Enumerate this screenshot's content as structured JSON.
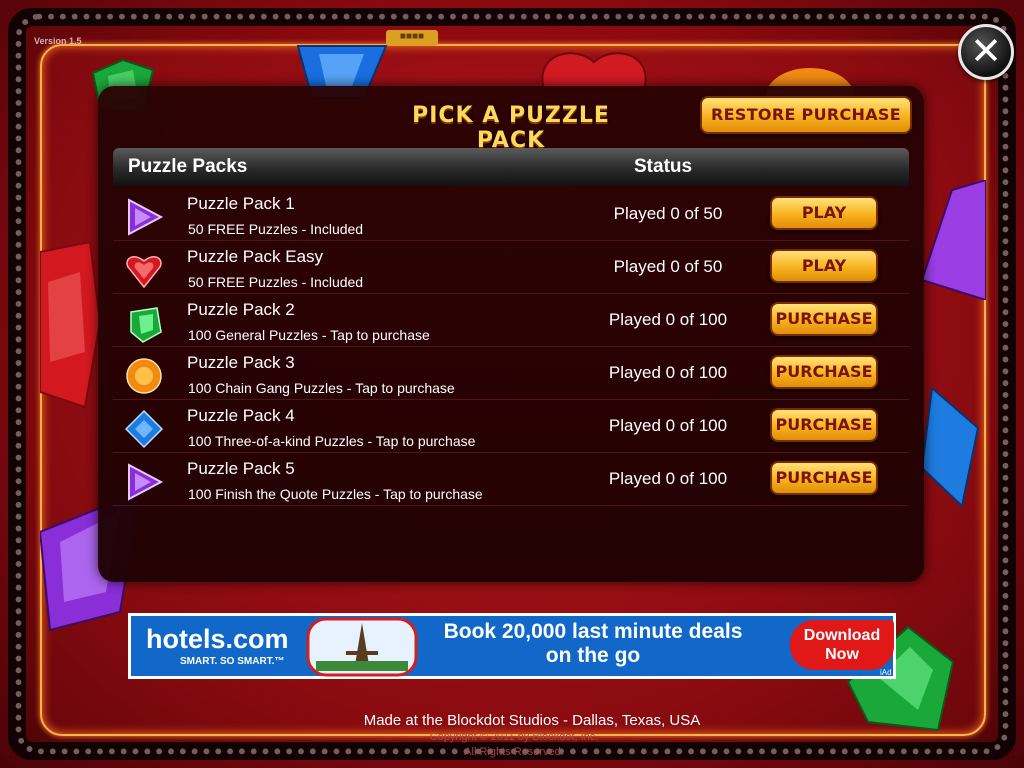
{
  "app": {
    "version": "Version 1.5",
    "top_tab": "■■■■"
  },
  "dialog": {
    "title": "PICK A PUZZLE PACK",
    "restore_label": "RESTORE PURCHASE",
    "close_label": "✕",
    "columns": {
      "packs": "Puzzle Packs",
      "status": "Status"
    },
    "packs": [
      {
        "name": "Puzzle Pack 1",
        "desc": "50 FREE Puzzles - Included",
        "status": "Played 0 of 50",
        "action": "PLAY",
        "icon": "purple-triangle-gem-icon"
      },
      {
        "name": "Puzzle Pack Easy",
        "desc": "50 FREE Puzzles - Included",
        "status": "Played 0 of 50",
        "action": "PLAY",
        "icon": "red-heart-gem-icon"
      },
      {
        "name": "Puzzle Pack 2",
        "desc": "100 General Puzzles - Tap to purchase",
        "status": "Played 0 of 100",
        "action": "PURCHASE",
        "icon": "green-gem-icon"
      },
      {
        "name": "Puzzle Pack 3",
        "desc": "100 Chain Gang Puzzles - Tap to purchase",
        "status": "Played 0 of 100",
        "action": "PURCHASE",
        "icon": "orange-round-gem-icon"
      },
      {
        "name": "Puzzle Pack 4",
        "desc": "100 Three-of-a-kind Puzzles - Tap to purchase",
        "status": "Played 0 of 100",
        "action": "PURCHASE",
        "icon": "blue-square-gem-icon"
      },
      {
        "name": "Puzzle Pack 5",
        "desc": "100 Finish the Quote Puzzles - Tap to purchase",
        "status": "Played 0 of 100",
        "action": "PURCHASE",
        "icon": "purple-triangle-gem-icon"
      }
    ]
  },
  "ad": {
    "brand": "hotels.com",
    "tagline": "SMART. SO SMART.™",
    "text_line1": "Book 20,000 last minute deals",
    "text_line2": "on the go",
    "cta_line1": "Download",
    "cta_line2": "Now",
    "iad": "iAd"
  },
  "footer": {
    "credit": "Made at the Blockdot Studios - Dallas, Texas, USA",
    "copyright": "Copyright © 2011 by Blockdot, Inc.",
    "rights": "All Rights Reserved."
  },
  "colors": {
    "button_gold": "#f7b21c",
    "button_text": "#7a1400",
    "title_gold": "#ffd75a",
    "ad_blue": "#1268c8",
    "ad_red": "#e01818"
  }
}
